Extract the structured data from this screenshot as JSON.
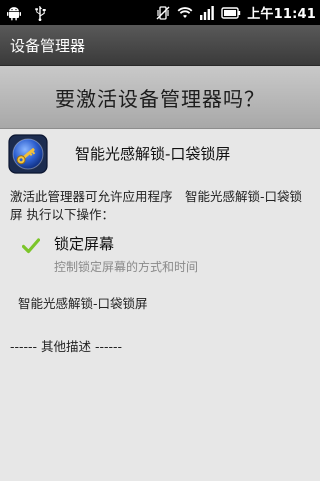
{
  "status_bar": {
    "icons": [
      "android-icon",
      "usb-icon",
      "vibrate-off-icon",
      "wifi-icon",
      "signal-icon",
      "battery-icon"
    ],
    "am_pm": "上午",
    "time": "11:41"
  },
  "title_bar": {
    "title": "设备管理器"
  },
  "header": {
    "question": "要激活设备管理器吗？"
  },
  "app": {
    "name": "智能光感解锁-口袋锁屏",
    "icon": "app-key-icon"
  },
  "content": {
    "intro": "激活此管理器可允许应用程序　智能光感解锁-口袋锁屏 执行以下操作：",
    "permissions": [
      {
        "title": "锁定屏幕",
        "description": "控制锁定屏幕的方式和时间"
      }
    ],
    "app_description": "智能光感解锁-口袋锁屏",
    "other_description": "------ 其他描述 ------"
  },
  "colors": {
    "status_bar": "#000000",
    "title_bar": "#4a4a4a",
    "banner": "#b8b8b8",
    "background": "#e7e7e7",
    "check_green": "#7cc52a"
  }
}
